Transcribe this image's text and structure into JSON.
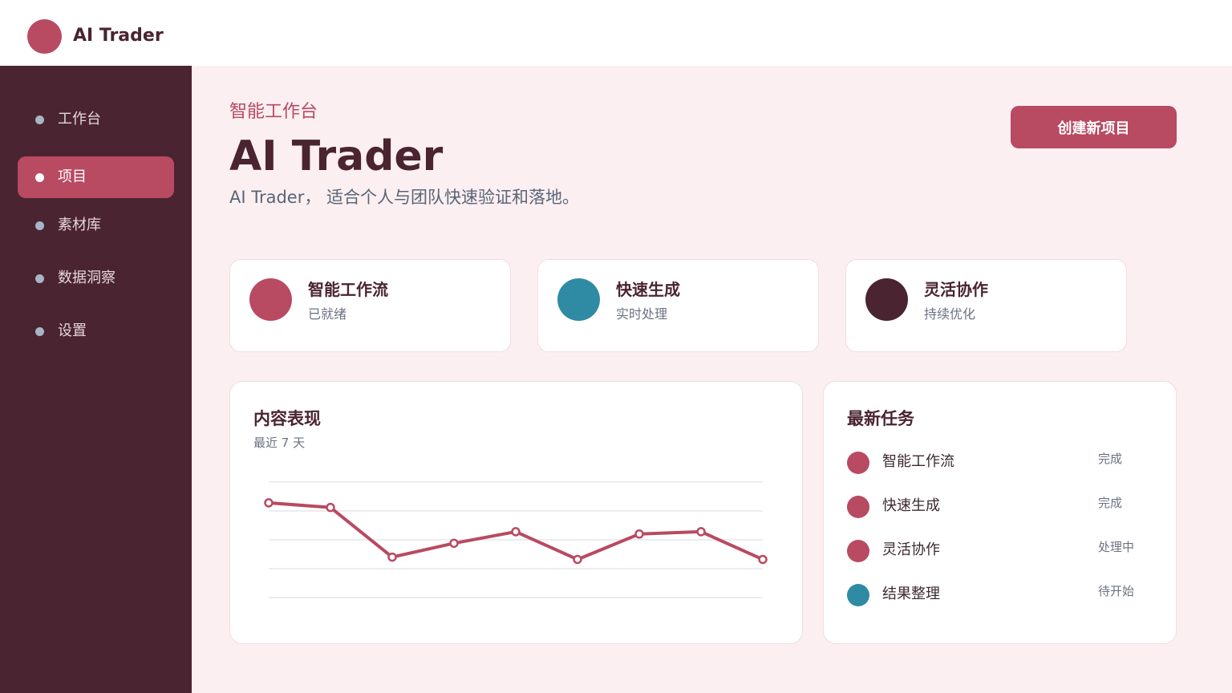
{
  "app": {
    "name": "AI Trader"
  },
  "sidebar": {
    "items": [
      {
        "label": "工作台",
        "active": false
      },
      {
        "label": "项目",
        "active": true
      },
      {
        "label": "素材库",
        "active": false
      },
      {
        "label": "数据洞察",
        "active": false
      },
      {
        "label": "设置",
        "active": false
      }
    ]
  },
  "header": {
    "eyebrow": "智能工作台",
    "title": "AI Trader",
    "subtitle": "AI Trader， 适合个人与团队快速验证和落地。",
    "create_button": "创建新项目"
  },
  "features": [
    {
      "title": "智能工作流",
      "status": "已就绪",
      "color": "#b84a62"
    },
    {
      "title": "快速生成",
      "status": "实时处理",
      "color": "#2e8ba3"
    },
    {
      "title": "灵活协作",
      "status": "持续优化",
      "color": "#4a2430"
    }
  ],
  "performance": {
    "title": "内容表现",
    "subtitle": "最近 7 天"
  },
  "chart_data": {
    "type": "line",
    "x": [
      1,
      2,
      3,
      4,
      5,
      6,
      7,
      8,
      9
    ],
    "series": [
      {
        "values": [
          82,
          78,
          35,
          47,
          57,
          33,
          55,
          57,
          33
        ]
      }
    ],
    "ylim": [
      0,
      100
    ],
    "grid": true,
    "color": "#b84a62"
  },
  "tasks": {
    "title": "最新任务",
    "items": [
      {
        "name": "智能工作流",
        "status": "完成",
        "color": "#b84a62"
      },
      {
        "name": "快速生成",
        "status": "完成",
        "color": "#b84a62"
      },
      {
        "name": "灵活协作",
        "status": "处理中",
        "color": "#b84a62"
      },
      {
        "name": "结果整理",
        "status": "待开始",
        "color": "#2e8ba3"
      }
    ]
  },
  "colors": {
    "primary": "#b84a62",
    "dark": "#4a2430",
    "teal": "#2e8ba3",
    "background": "#fbeff2"
  }
}
